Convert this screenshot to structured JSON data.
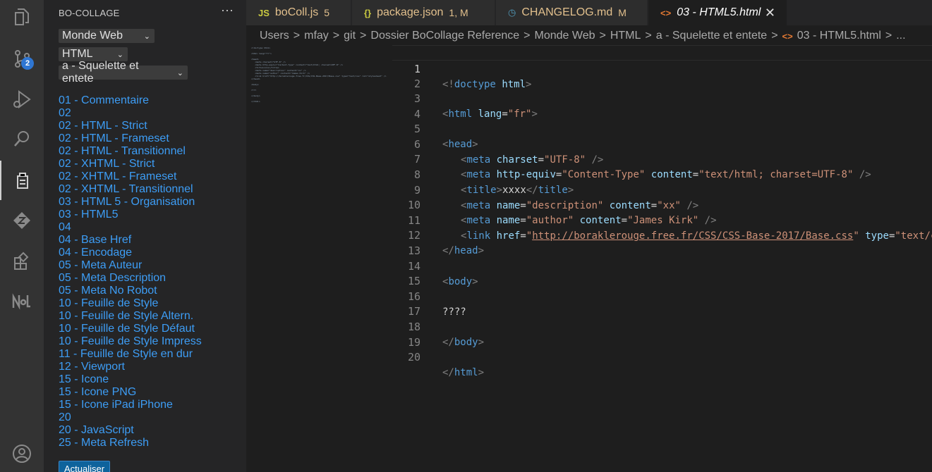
{
  "activity_bar": {
    "items": [
      {
        "icon": "files-icon"
      },
      {
        "icon": "source-control-icon",
        "badge": "2"
      },
      {
        "icon": "run-debug-icon"
      },
      {
        "icon": "search-icon"
      },
      {
        "icon": "bocollage-icon"
      },
      {
        "icon": "git-lens-icon"
      },
      {
        "icon": "extensions-icon"
      },
      {
        "icon": "nol-icon"
      },
      {
        "icon": "account-icon"
      }
    ]
  },
  "sidebar": {
    "title": "BO-COLLAGE",
    "more": "···",
    "select_category": "Monde Web",
    "select_language": "HTML",
    "select_section": "a - Squelette et entete",
    "entries": [
      "01 - Commentaire",
      "02",
      "02 - HTML - Strict",
      "02 - HTML - Frameset",
      "02 - HTML - Transitionnel",
      "02 - XHTML - Strict",
      "02 - XHTML - Frameset",
      "02 - XHTML - Transitionnel",
      "03 - HTML 5 - Organisation",
      "03 - HTML5",
      "04",
      "04 - Base Href",
      "04 - Encodage",
      "05 - Meta Auteur",
      "05 - Meta Description",
      "05 - Meta No Robot",
      "10 - Feuille de Style",
      "10 - Feuille de Style Altern.",
      "10 - Feuille de Style Défaut",
      "10 - Feuille de Style Impress",
      "11 - Feuille de Style en dur",
      "12 - Viewport",
      "15 - Icone",
      "15 - Icone PNG",
      "15 - Icone iPad iPhone",
      "20",
      "20 - JavaScript",
      "25 - Meta Refresh"
    ],
    "refresh_label": "Actualiser"
  },
  "tabs": [
    {
      "icon": "JS",
      "label": "boColl.js",
      "status": "5",
      "color": "#e2c08d",
      "icon_color": "#cbcb41"
    },
    {
      "icon": "{}",
      "label": "package.json",
      "status": "1, M",
      "color": "#e2c08d",
      "icon_color": "#cbcb41"
    },
    {
      "icon": "◷",
      "label": "CHANGELOG.md",
      "status": "M",
      "color": "#e2c08d",
      "icon_color": "#519aba"
    },
    {
      "icon": "<>",
      "label": "03 - HTML5.html",
      "status": "",
      "color": "#ffffff",
      "icon_color": "#e37933",
      "close": "✕"
    }
  ],
  "breadcrumb": [
    "Users",
    "mfay",
    "git",
    "Dossier BoCollage Reference",
    "Monde Web",
    "HTML",
    "a - Squelette et entete",
    "03 - HTML5.html",
    "..."
  ],
  "editor": {
    "line_numbers": [
      "1",
      "2",
      "3",
      "4",
      "5",
      "6",
      "7",
      "8",
      "9",
      "10",
      "11",
      "12",
      "13",
      "14",
      "15",
      "16",
      "17",
      "18",
      "19",
      "20"
    ],
    "current_line": "1",
    "link_url": "http://boraklerouge.free.fr/CSS/CSS-Base-2017/Base.css",
    "body_text": "????",
    "title_text": "xxxx",
    "lang": "\"fr\"",
    "charset": "\"UTF-8\"",
    "http_equiv": "\"Content-Type\"",
    "content_type": "\"text/html; charset=UTF-8\"",
    "description": "\"description\"",
    "description_content": "\"xx\"",
    "author": "\"author\"",
    "author_content": "\"James Kirk\""
  },
  "colors": {
    "accent": "#0e639c",
    "link_blue": "#3d9df5",
    "modified": "#e2c08d"
  }
}
